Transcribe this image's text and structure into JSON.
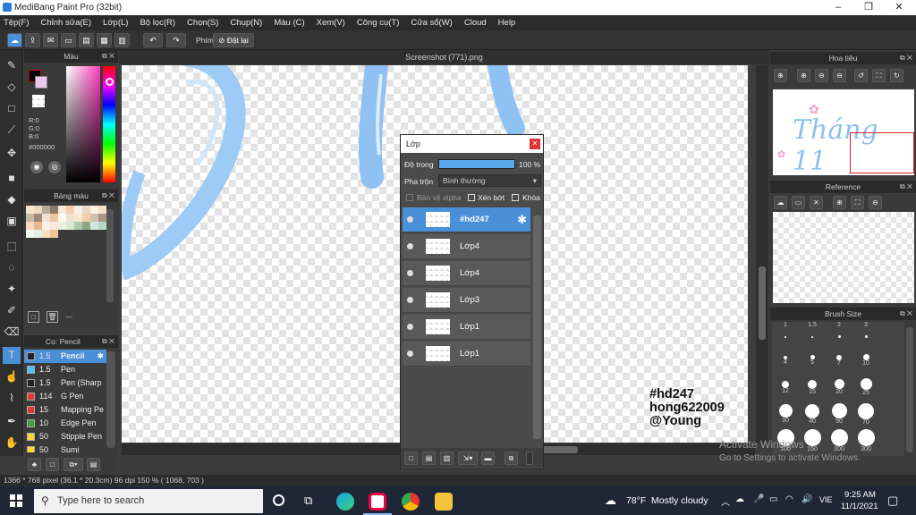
{
  "window": {
    "title": "MediBang Paint Pro (32bit)"
  },
  "menu": [
    "Tệp(F)",
    "Chỉnh sửa(E)",
    "Lớp(L)",
    "Bộ lọc(R)",
    "Chọn(S)",
    "Chụp(N)",
    "Màu (C)",
    "Xem(V)",
    "Công cụ(T)",
    "Cửa sổ(W)",
    "Cloud",
    "Help"
  ],
  "toolbar": {
    "phim_label": "Phím",
    "reset_label": "Đặt lại"
  },
  "color_panel": {
    "title": "Màu",
    "r": "R:0",
    "g": "G:0",
    "b": "B:0",
    "hex": "#000000"
  },
  "palette_panel": {
    "title": "Bảng màu",
    "footer": "---"
  },
  "brush_panel": {
    "title": "Cọ: Pencil",
    "items": [
      {
        "size": "1.5",
        "name": "Pencil",
        "color": "#222222"
      },
      {
        "size": "1.5",
        "name": "Pen",
        "color": "#4fc3f7"
      },
      {
        "size": "1.5",
        "name": "Pen (Sharp",
        "color": "#222222"
      },
      {
        "size": "114",
        "name": "G Pen",
        "color": "#e53935"
      },
      {
        "size": "15",
        "name": "Mapping Pe",
        "color": "#e53935"
      },
      {
        "size": "10",
        "name": "Edge Pen",
        "color": "#43a047"
      },
      {
        "size": "50",
        "name": "Stipple Pen",
        "color": "#fdd835"
      },
      {
        "size": "50",
        "name": "Sumi",
        "color": "#fdd835"
      }
    ]
  },
  "document": {
    "tab": "Screenshot (771).png"
  },
  "canvas_text": {
    "line1": "#hd247",
    "line2": "hong622009",
    "line3": "@Young"
  },
  "navigator": {
    "title": "Hoa tiêu",
    "preview_text": "Tháng 11"
  },
  "reference": {
    "title": "Reference"
  },
  "brush_size": {
    "title": "Brush Size",
    "sizes": [
      "1",
      "1.5",
      "2",
      "3",
      "4",
      "5",
      "7",
      "10",
      "12",
      "15",
      "20",
      "25",
      "30",
      "40",
      "50",
      "70",
      "100",
      "150",
      "200",
      "300"
    ]
  },
  "layer_dialog": {
    "title": "Lớp",
    "opacity_label": "Độ trong",
    "opacity_value": "100 %",
    "opacity": 1.0,
    "blend_label": "Pha trộn",
    "blend_value": "Bình thường",
    "protect_alpha": "Bảo vệ alpha",
    "clipping": "Xén bớt",
    "lock": "Khóa",
    "layers": [
      {
        "name": "#hd247",
        "selected": true
      },
      {
        "name": "Lớp4",
        "selected": false
      },
      {
        "name": "Lớp4",
        "selected": false
      },
      {
        "name": "Lớp3",
        "selected": false
      },
      {
        "name": "Lớp1",
        "selected": false
      },
      {
        "name": "Lớp1",
        "selected": false
      }
    ]
  },
  "status": {
    "text": "1366 * 768 pixel   (36.1 * 20.3cm)   96 dpi   150 %   ( 1068, 703 )"
  },
  "activation": {
    "line1": "Activate Windows",
    "line2": "Go to Settings to activate Windows."
  },
  "taskbar": {
    "search_placeholder": "Type here to search",
    "weather_temp": "78°F",
    "weather_desc": "Mostly cloudy",
    "lang": "VIE",
    "time": "9:25 AM",
    "date": "11/1/2021"
  }
}
